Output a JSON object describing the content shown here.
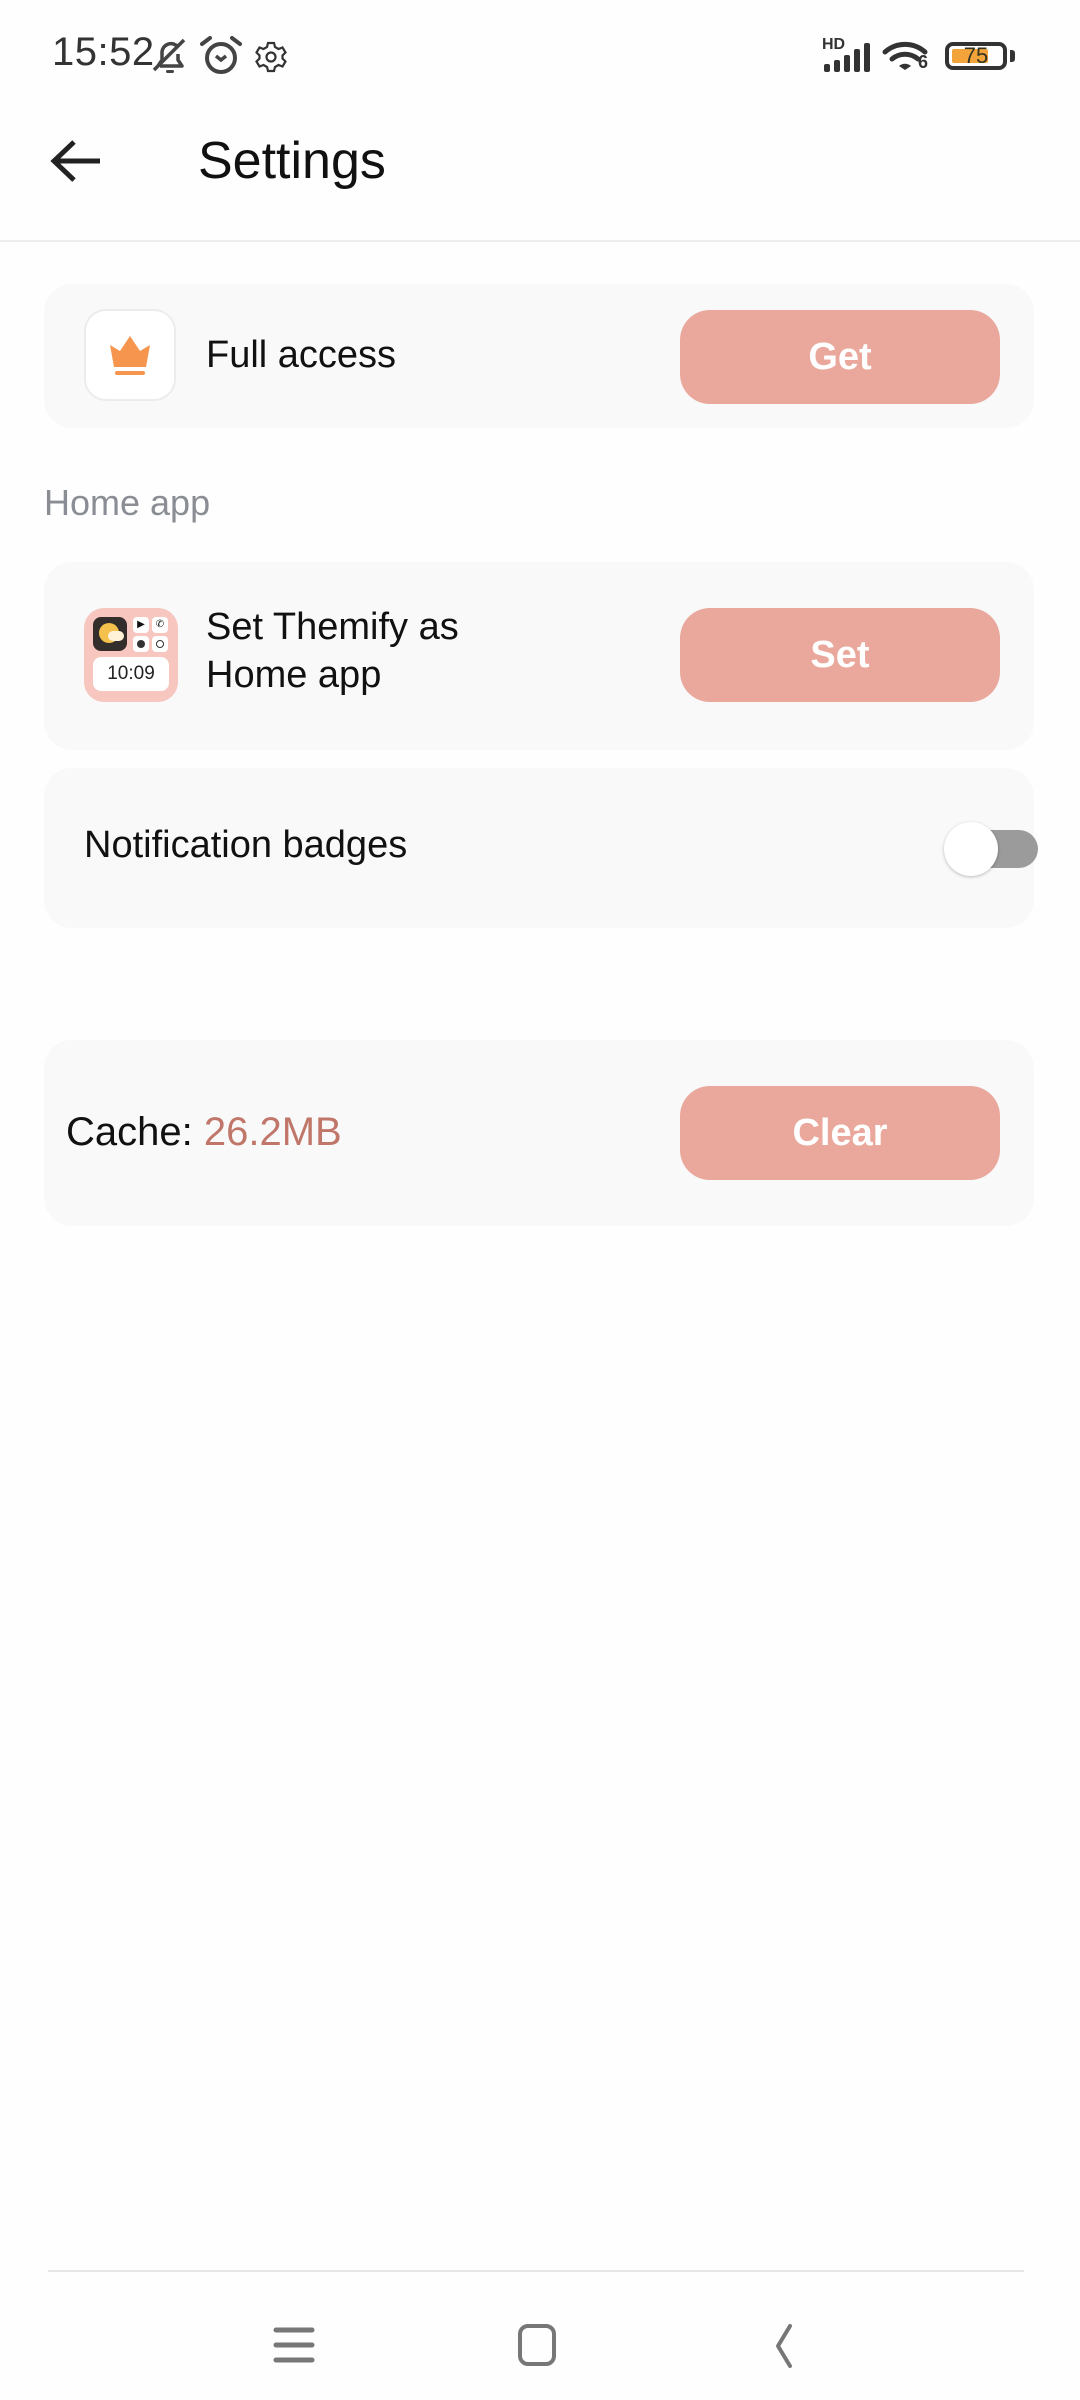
{
  "status_bar": {
    "time": "15:52",
    "left_icons": [
      "bell-off-icon",
      "alarm-clock-icon",
      "gear-icon"
    ],
    "network_label": "HD",
    "wifi_label": "6",
    "battery_percent": 75,
    "battery_text": "75"
  },
  "header": {
    "back_icon": "arrow-left-icon",
    "title": "Settings"
  },
  "full_access": {
    "icon": "crown-icon",
    "label": "Full access",
    "button_label": "Get"
  },
  "home_app_section": {
    "heading": "Home app",
    "set_home": {
      "icon": "themify-app-icon",
      "icon_clock_text": "10:09",
      "label_line1": "Set Themify as",
      "label_line2": "Home app",
      "button_label": "Set"
    },
    "notification_badges": {
      "label": "Notification badges",
      "enabled": false
    }
  },
  "cache": {
    "label": "Cache: ",
    "value": "26.2MB",
    "button_label": "Clear"
  },
  "nav_bar": {
    "items": [
      "menu-icon",
      "home-square-icon",
      "back-chevron-icon"
    ]
  },
  "colors": {
    "accent_button": "#eaa89c",
    "cache_value": "#c0776a",
    "crown": "#f5954e",
    "battery_fill": "#f2a43a"
  }
}
